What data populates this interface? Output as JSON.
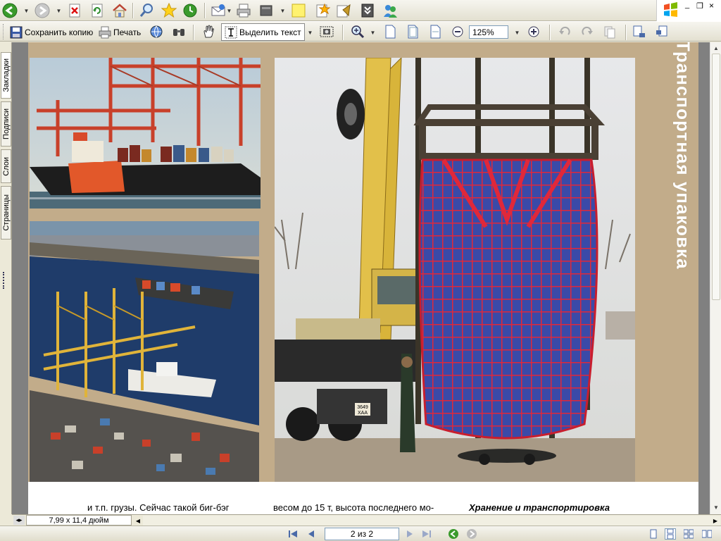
{
  "toolbar": {
    "save_copy_label": "Сохранить копию",
    "print_label": "Печать",
    "select_text_label": "Выделить текст",
    "zoom_value": "125%"
  },
  "sidebar": {
    "tabs": [
      {
        "label": "Закладки"
      },
      {
        "label": "Подписи"
      },
      {
        "label": "Слои"
      },
      {
        "label": "Страницы"
      }
    ]
  },
  "page": {
    "side_title": "Транспортная упаковка",
    "text_col1": "и  т.п.  грузы.  Сейчас  такой  биг-бэг",
    "text_col2": "весом до 15 т, высота последнего мо-",
    "text_col3": "Хранение и транспортировка",
    "truck_plate": "3649\nХАА"
  },
  "statusbar": {
    "page_size": "7,99 x 11,4 дюйм",
    "page_indicator": "2 из 2"
  },
  "colors": {
    "chrome": "#ece9d8",
    "page_background": "#c2ac8a",
    "bag_red": "#e0283a",
    "bag_blue": "#3a4aa8",
    "crane_yellow": "#d8b43a"
  }
}
